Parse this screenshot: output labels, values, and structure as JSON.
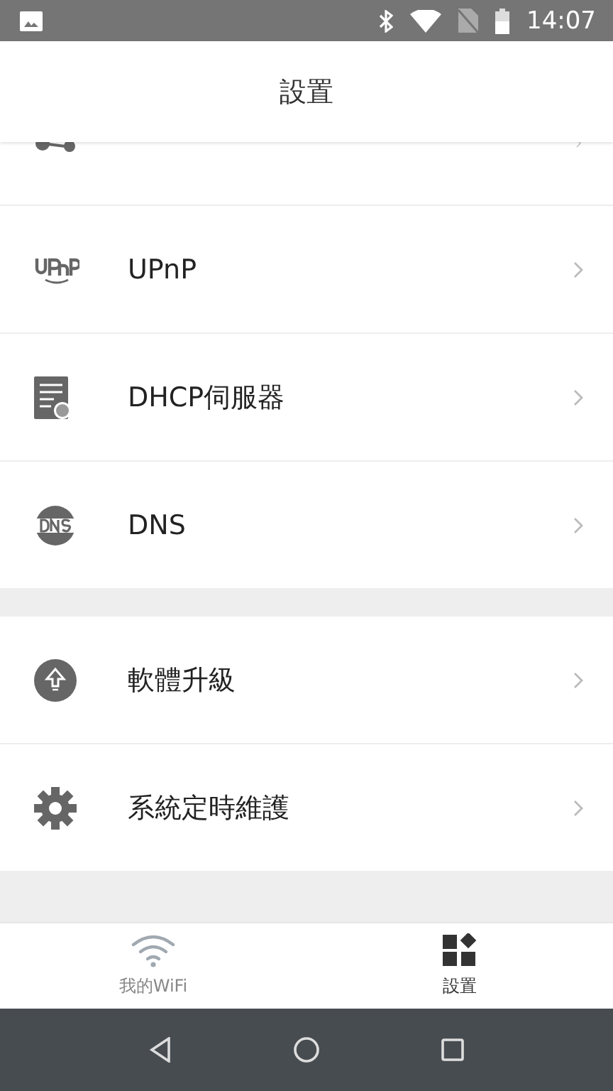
{
  "status_bar": {
    "time": "14:07"
  },
  "header": {
    "title": "設置"
  },
  "sections": [
    {
      "items": [
        {
          "kind": "ports"
        },
        {
          "kind": "upnp",
          "label": "UPnP"
        },
        {
          "kind": "dhcp",
          "label": "DHCP伺服器"
        },
        {
          "kind": "dns",
          "label": "DNS"
        }
      ]
    },
    {
      "items": [
        {
          "kind": "upgrade",
          "label": "軟體升級"
        },
        {
          "kind": "gear",
          "label": "系統定時維護"
        }
      ]
    }
  ],
  "bottom_tabs": [
    {
      "kind": "wifi",
      "label": "我的WiFi",
      "selected": false
    },
    {
      "kind": "grid",
      "label": "設置",
      "selected": true
    }
  ]
}
